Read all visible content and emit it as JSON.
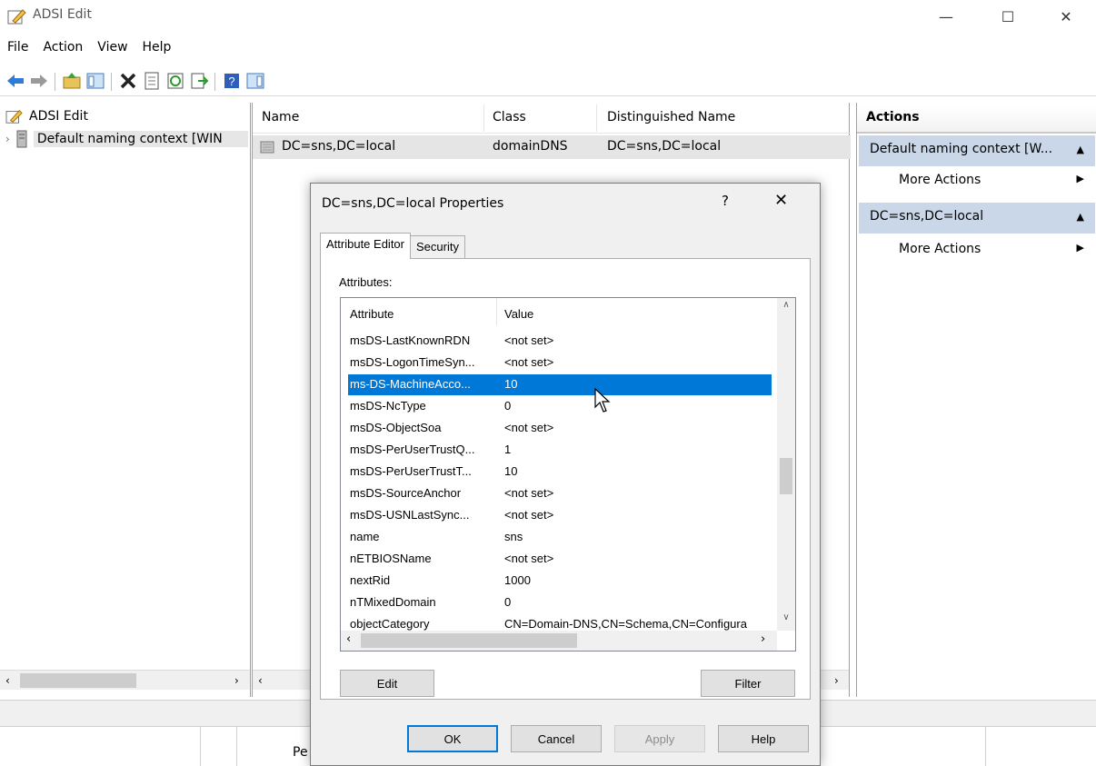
{
  "window": {
    "title": "ADSI Edit"
  },
  "menu": [
    "File",
    "Action",
    "View",
    "Help"
  ],
  "tree": {
    "root_label": "ADSI Edit",
    "child_label": "Default naming context [WIN"
  },
  "list": {
    "columns": [
      "Name",
      "Class",
      "Distinguished Name"
    ],
    "rows": [
      {
        "name": "DC=sns,DC=local",
        "class": "domainDNS",
        "dn": "DC=sns,DC=local"
      }
    ]
  },
  "actions": {
    "title": "Actions",
    "groups": [
      {
        "label": "Default naming context [W...",
        "item": "More Actions"
      },
      {
        "label": "DC=sns,DC=local",
        "item": "More Actions"
      }
    ]
  },
  "bottom": {
    "partial_text": "Pe"
  },
  "dialog": {
    "title": "DC=sns,DC=local Properties",
    "help": "?",
    "tabs": [
      "Attribute Editor",
      "Security"
    ],
    "attributes_label": "Attributes:",
    "columns": [
      "Attribute",
      "Value"
    ],
    "rows": [
      {
        "attr": "msDS-LastKnownRDN",
        "value": "<not set>"
      },
      {
        "attr": "msDS-LogonTimeSyn...",
        "value": "<not set>"
      },
      {
        "attr": "ms-DS-MachineAcco...",
        "value": "10"
      },
      {
        "attr": "msDS-NcType",
        "value": "0"
      },
      {
        "attr": "msDS-ObjectSoa",
        "value": "<not set>"
      },
      {
        "attr": "msDS-PerUserTrustQ...",
        "value": "1"
      },
      {
        "attr": "msDS-PerUserTrustT...",
        "value": "10"
      },
      {
        "attr": "msDS-SourceAnchor",
        "value": "<not set>"
      },
      {
        "attr": "msDS-USNLastSync...",
        "value": "<not set>"
      },
      {
        "attr": "name",
        "value": "sns"
      },
      {
        "attr": "nETBIOSName",
        "value": "<not set>"
      },
      {
        "attr": "nextRid",
        "value": "1000"
      },
      {
        "attr": "nTMixedDomain",
        "value": "0"
      },
      {
        "attr": "objectCategory",
        "value": "CN=Domain-DNS,CN=Schema,CN=Configura"
      }
    ],
    "selected_row": "ms-DS-MachineAcco...",
    "edit_button": "Edit",
    "filter_button": "Filter",
    "ok_button": "OK",
    "cancel_button": "Cancel",
    "apply_button": "Apply",
    "help_button": "Help"
  },
  "colors": {
    "selection": "#0078d7",
    "actions_group": "#c9d7e8"
  }
}
